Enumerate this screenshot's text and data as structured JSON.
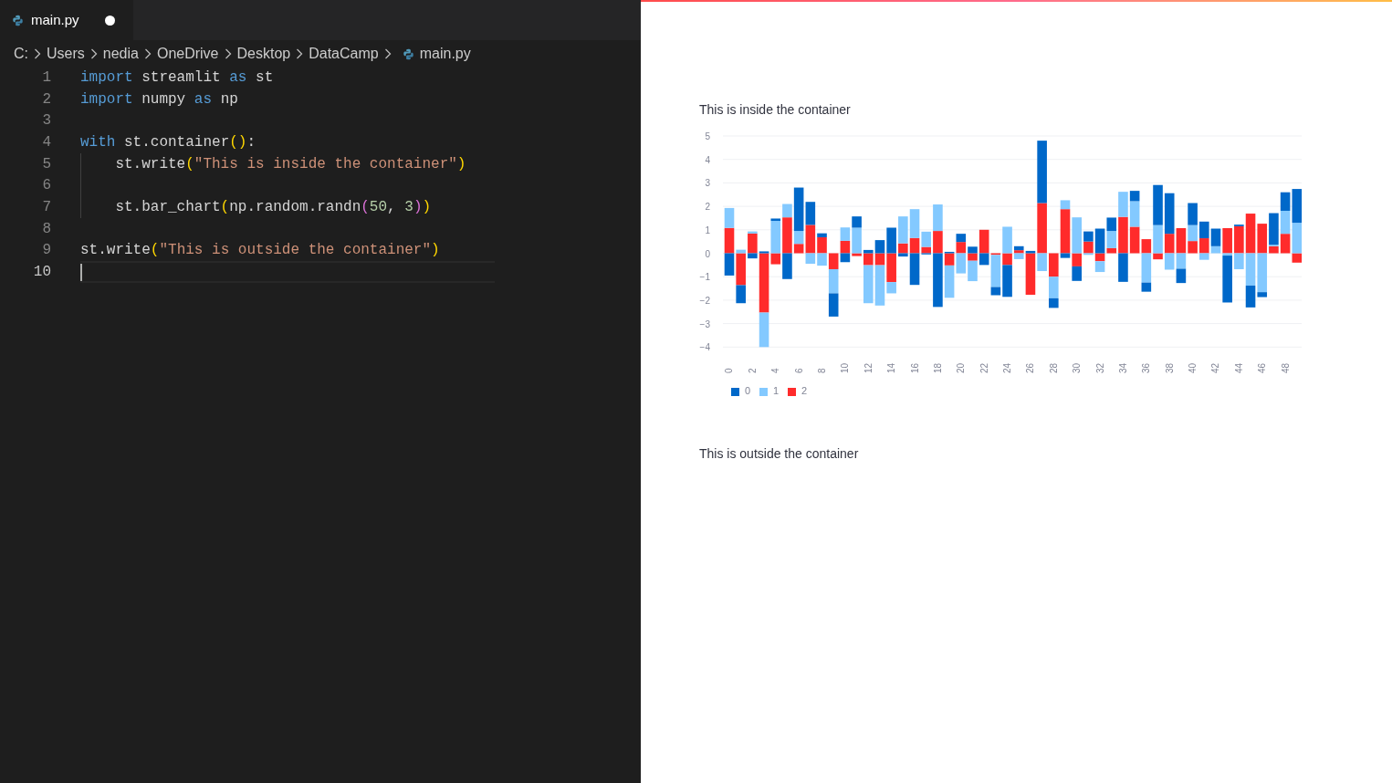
{
  "editor": {
    "tab": {
      "label": "main.py",
      "modified": true
    },
    "breadcrumb": [
      "C:",
      "Users",
      "nedia",
      "OneDrive",
      "Desktop",
      "DataCamp",
      "main.py"
    ],
    "lines": [
      {
        "number": "1",
        "indented": false,
        "current": false,
        "tokens": [
          {
            "kind": "keyword",
            "text": "import"
          },
          {
            "kind": "plain",
            "text": " streamlit "
          },
          {
            "kind": "keyword",
            "text": "as"
          },
          {
            "kind": "plain",
            "text": " st"
          }
        ]
      },
      {
        "number": "2",
        "indented": false,
        "current": false,
        "tokens": [
          {
            "kind": "keyword",
            "text": "import"
          },
          {
            "kind": "plain",
            "text": " numpy "
          },
          {
            "kind": "keyword",
            "text": "as"
          },
          {
            "kind": "plain",
            "text": " np"
          }
        ]
      },
      {
        "number": "3",
        "indented": false,
        "current": false
      },
      {
        "number": "4",
        "indented": false,
        "current": false,
        "tokens": [
          {
            "kind": "keyword",
            "text": "with"
          },
          {
            "kind": "plain",
            "text": " st.container"
          },
          {
            "kind": "bracket1",
            "text": "()"
          },
          {
            "kind": "plain",
            "text": ":"
          }
        ]
      },
      {
        "number": "5",
        "indented": true,
        "current": false,
        "tokens": [
          {
            "kind": "plain",
            "text": "st.write"
          },
          {
            "kind": "bracket1",
            "text": "("
          },
          {
            "kind": "string",
            "text": "\"This is inside the container\""
          },
          {
            "kind": "bracket1",
            "text": ")"
          }
        ]
      },
      {
        "number": "6",
        "indented": true,
        "current": false
      },
      {
        "number": "7",
        "indented": true,
        "current": false,
        "tokens": [
          {
            "kind": "plain",
            "text": "st.bar_chart"
          },
          {
            "kind": "bracket1",
            "text": "("
          },
          {
            "kind": "plain",
            "text": "np.random.randn"
          },
          {
            "kind": "bracket2",
            "text": "("
          },
          {
            "kind": "number",
            "text": "50"
          },
          {
            "kind": "plain",
            "text": ", "
          },
          {
            "kind": "number",
            "text": "3"
          },
          {
            "kind": "bracket2",
            "text": ")"
          },
          {
            "kind": "bracket1",
            "text": ")"
          }
        ]
      },
      {
        "number": "8",
        "indented": false,
        "current": false
      },
      {
        "number": "9",
        "indented": false,
        "current": false,
        "tokens": [
          {
            "kind": "plain",
            "text": "st.write"
          },
          {
            "kind": "bracket1",
            "text": "("
          },
          {
            "kind": "string",
            "text": "\"This is outside the container\""
          },
          {
            "kind": "bracket1",
            "text": ")"
          }
        ]
      },
      {
        "number": "10",
        "indented": false,
        "current": true
      }
    ]
  },
  "app": {
    "inside_text": "This is inside the container",
    "chart_data": {
      "type": "bar",
      "stacked": true,
      "grid": true,
      "legend": true,
      "xlim": [
        -0.5,
        49.5
      ],
      "ylim": [
        -4,
        5
      ],
      "x": [
        0,
        1,
        2,
        3,
        4,
        5,
        6,
        7,
        8,
        9,
        10,
        11,
        12,
        13,
        14,
        15,
        16,
        17,
        18,
        19,
        20,
        21,
        22,
        23,
        24,
        25,
        26,
        27,
        28,
        29,
        30,
        31,
        32,
        33,
        34,
        35,
        36,
        37,
        38,
        39,
        40,
        41,
        42,
        43,
        44,
        45,
        46,
        47,
        48,
        49
      ],
      "xticks": [
        0,
        2,
        4,
        6,
        8,
        10,
        12,
        14,
        16,
        18,
        20,
        22,
        24,
        26,
        28,
        30,
        32,
        34,
        36,
        38,
        40,
        42,
        44,
        46,
        48
      ],
      "yticks": [
        {
          "value": 5,
          "label": "5"
        },
        {
          "value": 4,
          "label": "4"
        },
        {
          "value": 3,
          "label": "3"
        },
        {
          "value": 2,
          "label": "2"
        },
        {
          "value": 1,
          "label": "1"
        },
        {
          "value": 0,
          "label": "0"
        },
        {
          "value": -1,
          "label": "−1"
        },
        {
          "value": -2,
          "label": "−2"
        },
        {
          "value": -3,
          "label": "−3"
        },
        {
          "value": -4,
          "label": "−4"
        }
      ],
      "series": [
        {
          "name": "0",
          "color": "#0068c9",
          "values": [
            -0.95,
            -0.77,
            -0.22,
            0.08,
            0.1,
            -1.1,
            1.85,
            0.98,
            0.17,
            -0.99,
            -0.38,
            0.48,
            0.14,
            0.56,
            1.09,
            -0.14,
            -1.35,
            -0.05,
            -2.29,
            0.06,
            0.35,
            0.28,
            -0.5,
            -0.35,
            -1.36,
            0.17,
            0.1,
            2.66,
            -0.41,
            -0.2,
            -0.62,
            0.43,
            1.05,
            0.57,
            -1.22,
            0.44,
            -0.39,
            1.71,
            1.73,
            -0.61,
            0.94,
            0.71,
            0.75,
            -2.0,
            0.07,
            -0.93,
            -0.21,
            1.35,
            0.79,
            1.44
          ]
        },
        {
          "name": "1",
          "color": "#83c9ff",
          "values": [
            0.85,
            0.15,
            0.09,
            -1.47,
            1.38,
            0.57,
            0.55,
            -0.45,
            -0.53,
            -1.03,
            0.57,
            1.09,
            -1.62,
            -1.72,
            -0.48,
            1.15,
            1.23,
            0.65,
            1.13,
            -1.38,
            -0.86,
            -0.87,
            null,
            -1.37,
            1.13,
            -0.25,
            null,
            -0.76,
            -0.92,
            0.38,
            1.53,
            -0.07,
            -0.46,
            0.73,
            1.07,
            1.09,
            -1.25,
            1.2,
            -0.7,
            -0.66,
            0.68,
            -0.28,
            0.3,
            -0.1,
            -0.68,
            -1.38,
            -1.66,
            0.06,
            0.98,
            1.3
          ]
        },
        {
          "name": "2",
          "color": "#ff2b2b",
          "values": [
            1.08,
            -1.36,
            0.84,
            -2.53,
            -0.47,
            1.53,
            0.4,
            1.21,
            0.68,
            -0.68,
            0.53,
            -0.12,
            -0.51,
            -0.51,
            -1.23,
            0.42,
            0.65,
            0.27,
            0.95,
            -0.52,
            0.48,
            -0.32,
            1.0,
            -0.07,
            -0.5,
            0.13,
            -1.77,
            2.14,
            -1.0,
            1.88,
            -0.56,
            0.5,
            -0.34,
            0.22,
            1.55,
            1.13,
            0.6,
            -0.26,
            0.83,
            1.07,
            0.52,
            0.64,
            null,
            1.07,
            1.15,
            1.69,
            1.26,
            0.3,
            0.83,
            -0.4
          ]
        }
      ]
    },
    "outside_text": "This is outside the container"
  }
}
